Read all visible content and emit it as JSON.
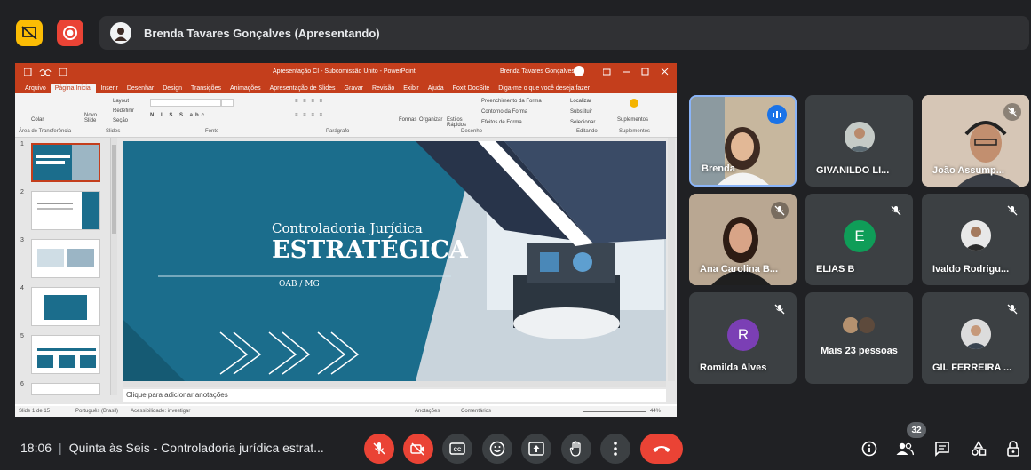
{
  "presenter": {
    "name": "Brenda Tavares Gonçalves (Apresentando)"
  },
  "powerpoint": {
    "window_title": "Apresentação  CI - Subcomissão Unito - PowerPoint",
    "user": "Brenda Tavares Gonçalves",
    "tabs": [
      "Arquivo",
      "Página Inicial",
      "Inserir",
      "Desenhar",
      "Design",
      "Transições",
      "Animações",
      "Apresentação de Slides",
      "Gravar",
      "Revisão",
      "Exibir",
      "Ajuda",
      "Foxit DocSite",
      "Diga-me o que você deseja fazer"
    ],
    "active_tab": "Página Inicial",
    "ribbon_groups": [
      "Área de Transferência",
      "Slides",
      "Fonte",
      "Parágrafo",
      "Desenho",
      "Editando",
      "Suplementos"
    ],
    "ribbon_items": {
      "new_slide": "Novo Slide",
      "layout": "Layout",
      "reset": "Redefinir",
      "section": "Seção",
      "shapes": "Formas",
      "arrange": "Organizar",
      "quick_styles": "Estilos Rápidos",
      "fill": "Preenchimento da Forma",
      "outline": "Contorno da Forma",
      "effects": "Efeitos de Forma",
      "find": "Localizar",
      "replace": "Substituir",
      "select": "Selecionar",
      "addins": "Suplementos",
      "paste": "Colar"
    },
    "slide_numbers": [
      "1",
      "2",
      "3",
      "4",
      "5",
      "6"
    ],
    "slide": {
      "subtitle": "Controladoria Jurídica",
      "title": "ESTRATÉGICA",
      "org": "OAB / MG"
    },
    "notes_placeholder": "Clique para adicionar anotações",
    "status": {
      "slide_count": "Slide 1 de 15",
      "language": "Português (Brasil)",
      "accessibility": "Acessibilidade: investigar",
      "notes": "Anotações",
      "comments": "Comentários",
      "zoom": "44%"
    }
  },
  "participants": [
    {
      "name": "Brenda",
      "speaking": true
    },
    {
      "name": "GIVANILDO LI...",
      "muted": false
    },
    {
      "name": "João Assump...",
      "muted": true
    },
    {
      "name": "Ana Carolina B...",
      "muted": true
    },
    {
      "name": "ELIAS B",
      "muted": true,
      "initial": "E",
      "color": "#0f9d58"
    },
    {
      "name": "Ivaldo Rodrigu...",
      "muted": true
    },
    {
      "name": "Romilda Alves",
      "muted": true,
      "initial": "R",
      "color": "#7b3fb5"
    },
    {
      "name": "Mais 23 pessoas"
    },
    {
      "name": "GIL FERREIRA ...",
      "muted": true
    }
  ],
  "meeting": {
    "time": "18:06",
    "title": "Quinta às Seis - Controladoria jurídica estrat...",
    "participant_count": "32"
  },
  "colors": {
    "background": "#202124",
    "accent": "#1a73e8",
    "danger": "#ea4335",
    "powerpoint": "#c43e1c",
    "slide_teal": "#1b6d8c"
  }
}
